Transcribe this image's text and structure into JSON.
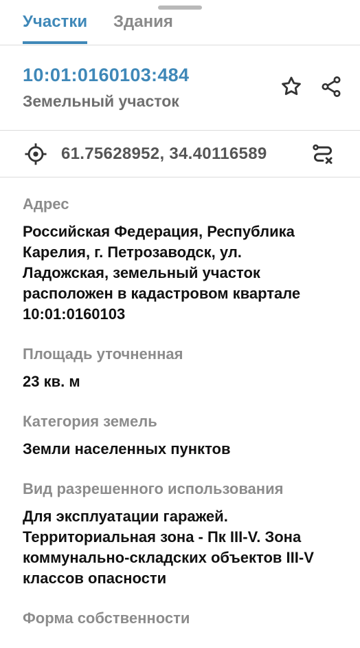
{
  "tabs": [
    {
      "label": "Участки"
    },
    {
      "label": "Здания"
    }
  ],
  "header": {
    "cadastral_number": "10:01:0160103:484",
    "object_type": "Земельный участок"
  },
  "coordinates": {
    "text": "61.75628952, 34.40116589"
  },
  "fields": [
    {
      "label": "Адрес",
      "lines": [
        "Российская Федерация, Республика",
        "Карелия, г. Петрозаводск, ул.",
        "Ладожская, земельный участок",
        "расположен в кадастровом квартале",
        "10:01:0160103"
      ]
    },
    {
      "label": "Площадь уточненная",
      "lines": [
        "23 кв. м"
      ]
    },
    {
      "label": "Категория земель",
      "lines": [
        "Земли населенных пунктов"
      ]
    },
    {
      "label": "Вид разрешенного использования",
      "lines": [
        "Для эксплуатации гаражей.",
        "Территориальная зона - Пк III-V. Зона",
        "коммунально-складских объектов III-V",
        "классов опасности"
      ]
    },
    {
      "label": "Форма собственности",
      "lines": []
    }
  ],
  "colors": {
    "accent": "#3f88b8",
    "label_gray": "#8c8c8c",
    "divider": "#dcdcdc"
  },
  "icons": [
    "star-icon",
    "share-icon",
    "crosshair-icon",
    "route-icon"
  ]
}
